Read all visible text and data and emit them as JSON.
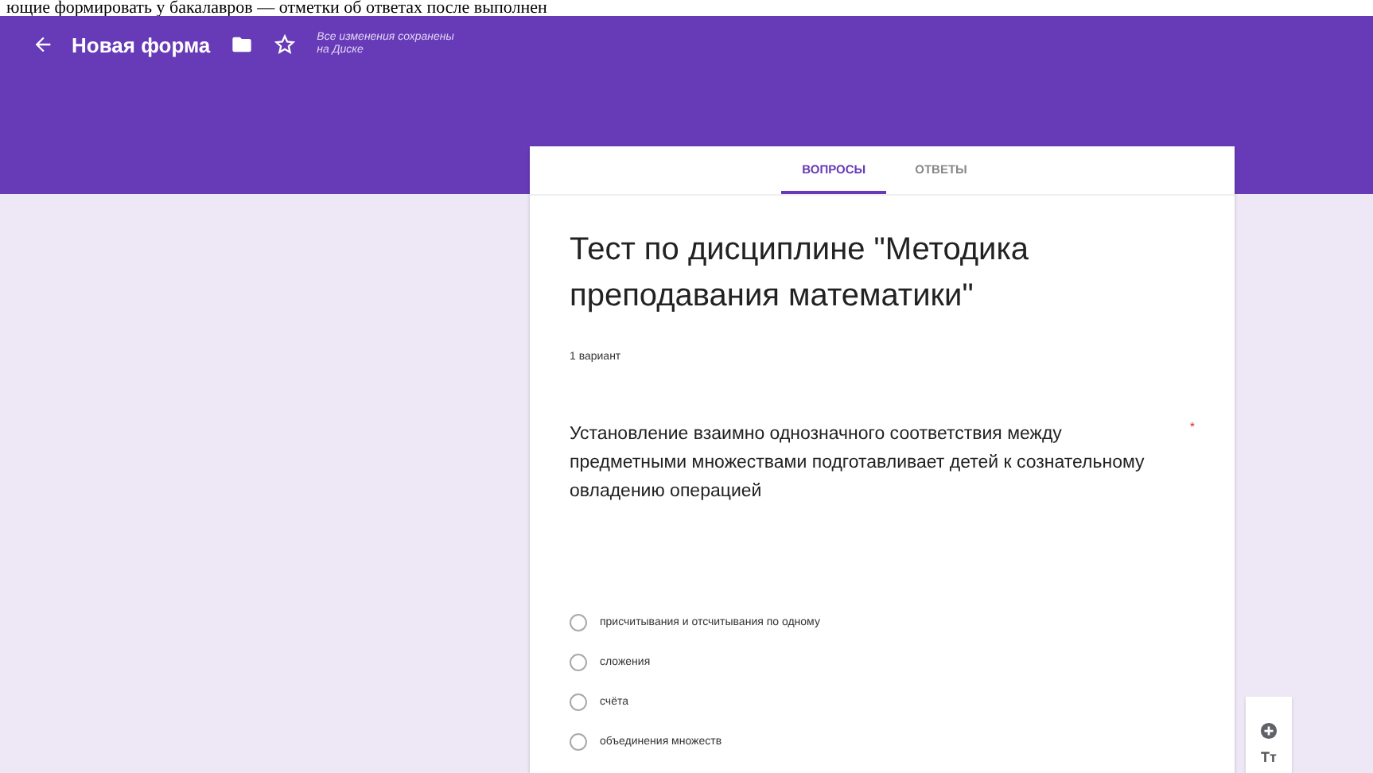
{
  "document_line": "ющие формировать у бакалавров — отметки об ответах после выполнен",
  "header": {
    "title": "Новая форма",
    "save_status": "Все изменения сохранены на Диске"
  },
  "tabs": [
    {
      "label": "ВОПРОСЫ",
      "selected": true
    },
    {
      "label": "ОТВЕТЫ",
      "selected": false
    }
  ],
  "form": {
    "title": "Тест по дисциплине \"Методика преподавания математики\"",
    "description": "1 вариант"
  },
  "question": {
    "text": "Установление взаимно однозначного соответствия между предметными множествами подготавливает детей к сознательному овладению операцией",
    "required_mark": "*",
    "options": [
      {
        "label": "присчитывания и отсчитывания по одному",
        "selected": false
      },
      {
        "label": "сложения",
        "selected": false
      },
      {
        "label": "счёта",
        "selected": false
      },
      {
        "label": "объединения множеств",
        "selected": false
      }
    ]
  },
  "side_toolbar": {
    "text_tool": "Тт"
  }
}
